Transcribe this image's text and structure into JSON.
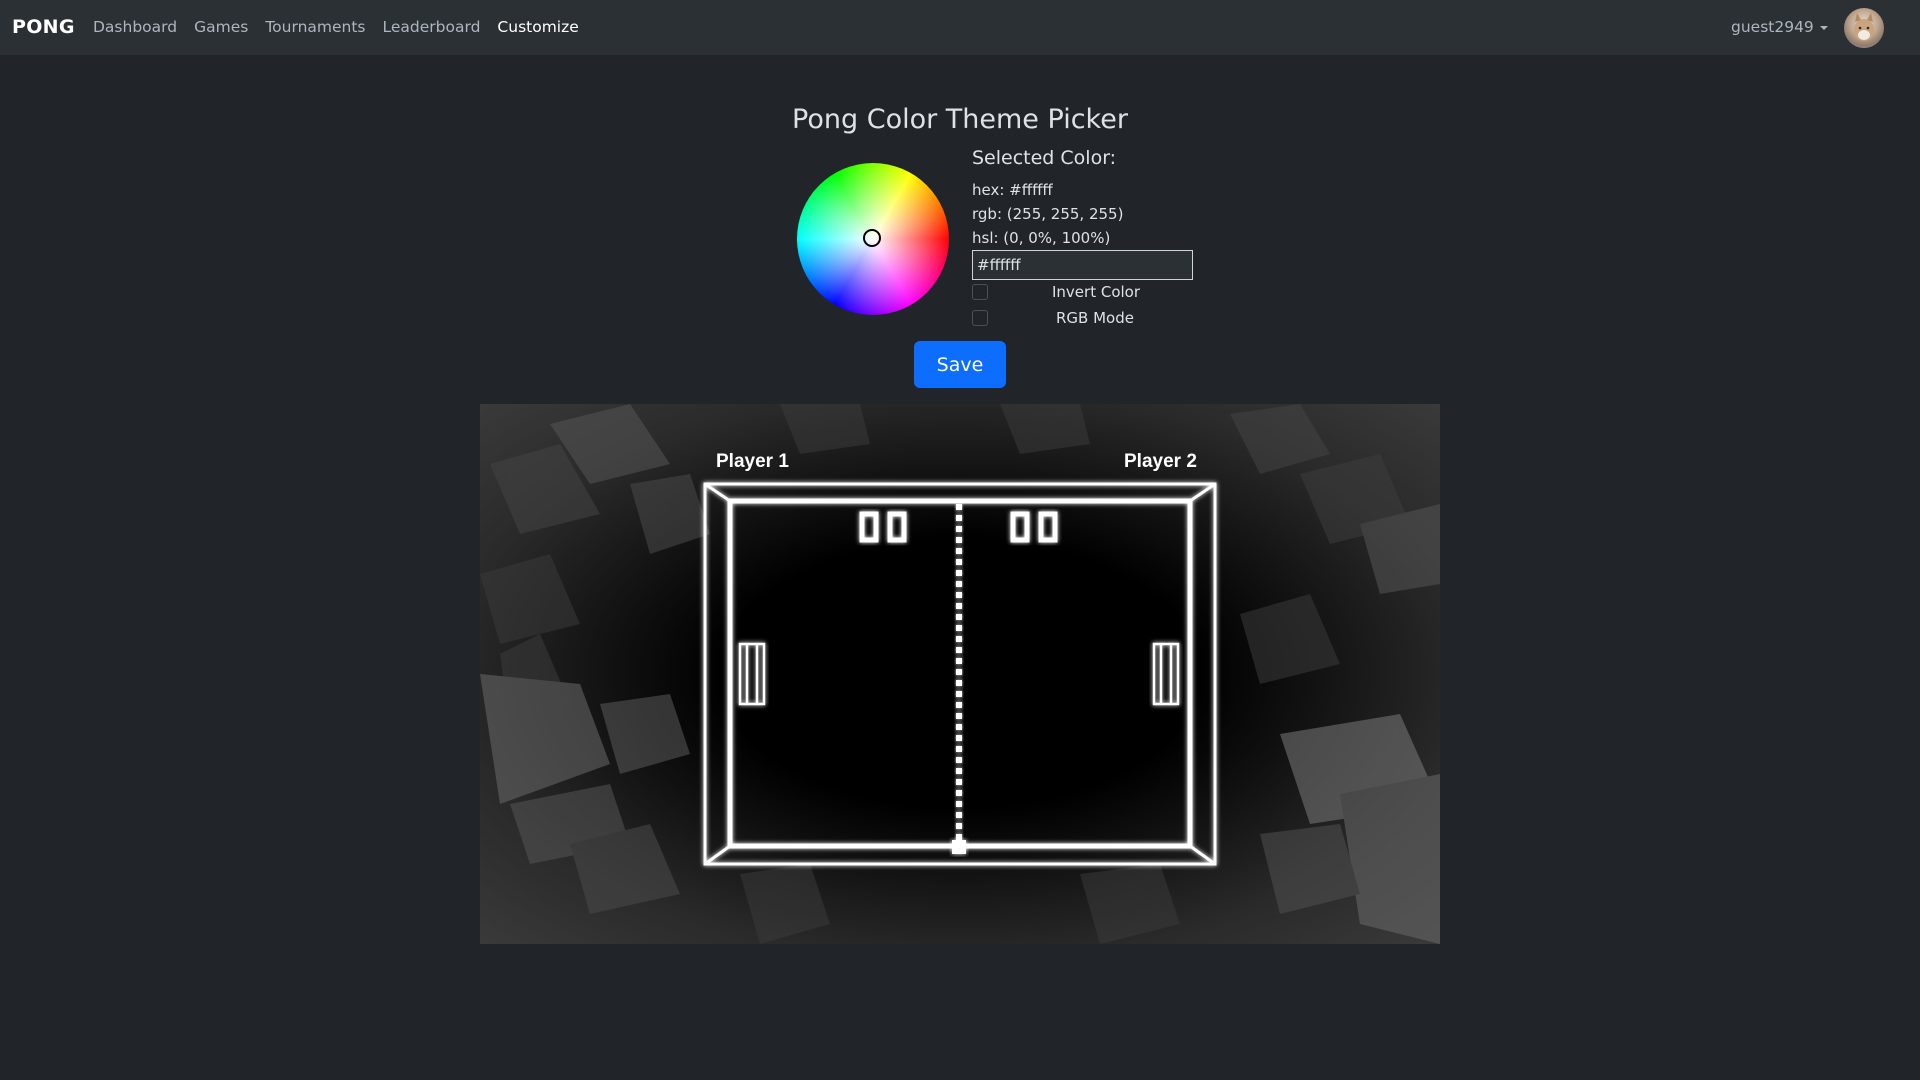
{
  "nav": {
    "brand": "PONG",
    "links": [
      "Dashboard",
      "Games",
      "Tournaments",
      "Leaderboard",
      "Customize"
    ],
    "active": "Customize",
    "user": "guest2949"
  },
  "picker": {
    "title": "Pong Color Theme Picker",
    "selected_label": "Selected Color:",
    "hex": "hex: #ffffff",
    "rgb": "rgb: (255, 255, 255)",
    "hsl": "hsl: (0, 0%, 100%)",
    "input_value": "#ffffff",
    "invert_label": "Invert Color",
    "rgb_mode_label": "RGB Mode",
    "save_label": "Save"
  },
  "game": {
    "player1": "Player 1",
    "player2": "Player 2",
    "score_left": "00",
    "score_right": "00",
    "theme_color": "#ffffff"
  }
}
